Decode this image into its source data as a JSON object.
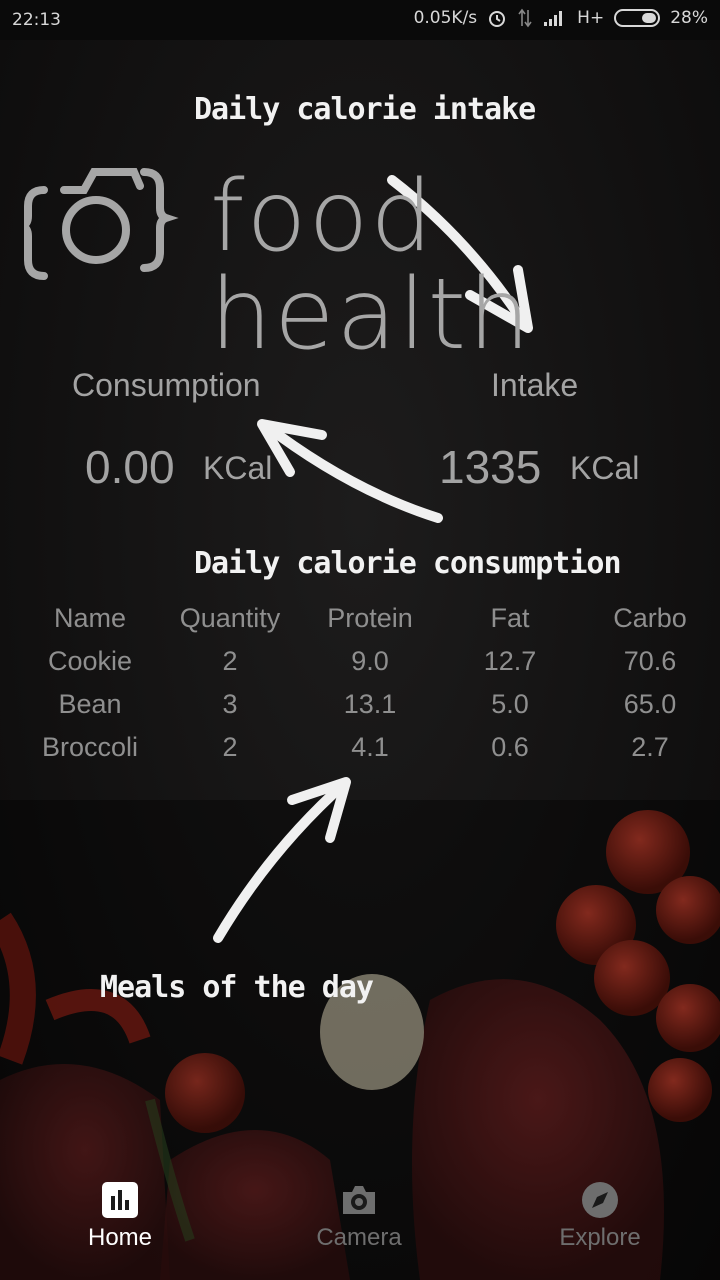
{
  "status_bar": {
    "time": "22:13",
    "network_speed": "0.05K/s",
    "network_type": "H+",
    "battery": "28%",
    "icons": [
      "alarm-icon",
      "data-arrows-icon",
      "signal-icon",
      "battery-icon"
    ]
  },
  "annotations": {
    "intake_note": "Daily calorie intake",
    "consumption_note": "Daily calorie consumption",
    "meals_note": "Meals of the day"
  },
  "logo": {
    "icon": "camera-braces-icon",
    "text": "food health"
  },
  "stats": {
    "consumption_label": "Consumption",
    "consumption_value": "0.00",
    "consumption_unit": "KCal",
    "intake_label": "Intake",
    "intake_value": "1335",
    "intake_unit": "KCal"
  },
  "meals": {
    "headers": [
      "Name",
      "Quantity",
      "Protein",
      "Fat",
      "Carbo"
    ],
    "rows": [
      [
        "Cookie",
        "2",
        "9.0",
        "12.7",
        "70.6"
      ],
      [
        "Bean",
        "3",
        "13.1",
        "5.0",
        "65.0"
      ],
      [
        "Broccoli",
        "2",
        "4.1",
        "0.6",
        "2.7"
      ]
    ]
  },
  "nav": {
    "home": "Home",
    "camera": "Camera",
    "explore": "Explore",
    "home_icon": "bar-chart-icon",
    "camera_icon": "camera-icon",
    "explore_icon": "compass-icon",
    "active_color": "#ffffff",
    "inactive_color": "#6e6e6e"
  }
}
